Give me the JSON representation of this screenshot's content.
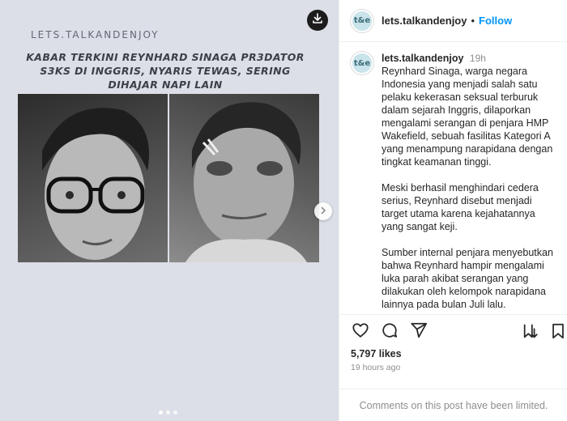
{
  "post": {
    "brand_watermark": "LETS.TALKANDENJOY",
    "headline": "KABAR TERKINI REYNHARD SINAGA PR3DATOR S3KS DI INGGRIS, NYARIS TEWAS, SERING DIHAJAR NAPI LAIN",
    "carousel_dots": 3,
    "active_dot": 1
  },
  "header": {
    "username": "lets.talkandenjoy",
    "separator": "•",
    "follow_label": "Follow",
    "avatar_text": "t&e"
  },
  "caption": {
    "username": "lets.talkandenjoy",
    "time": "19h",
    "paragraphs": [
      "Reynhard Sinaga, warga negara Indonesia yang menjadi salah satu pelaku kekerasan seksual terburuk dalam sejarah Inggris, dilaporkan mengalami serangan di penjara HMP Wakefield, sebuah fasilitas Kategori A yang menampung narapidana dengan tingkat keamanan tinggi.",
      "Meski berhasil menghindari cedera serius, Reynhard disebut menjadi target utama karena kejahatannya yang sangat keji.",
      "Sumber internal penjara menyebutkan bahwa Reynhard hampir mengalami luka parah akibat serangan yang dilakukan oleh kelompok narapidana lainnya pada bulan Juli lalu."
    ]
  },
  "stats": {
    "likes": "5,797 likes",
    "posted_ago": "19 hours ago"
  },
  "comments": {
    "limited_text": "Comments on this post have been limited."
  },
  "icons": {
    "download": "download-icon",
    "next": "chevron-right-icon",
    "like": "heart-icon",
    "comment": "comment-icon",
    "share": "paper-plane-icon",
    "save_collection": "save-to-collection-icon",
    "bookmark": "bookmark-icon"
  },
  "colors": {
    "accent": "#0095f6",
    "media_bg": "#dcdfe7",
    "muted_text": "#8e8e8e"
  }
}
